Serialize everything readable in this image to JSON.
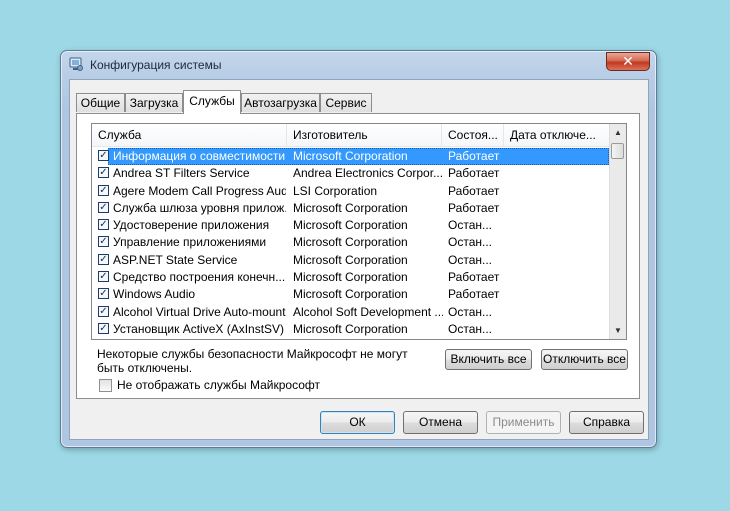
{
  "window": {
    "title": "Конфигурация системы",
    "close_glyph": "✕"
  },
  "tabs": [
    {
      "label": "Общие"
    },
    {
      "label": "Загрузка"
    },
    {
      "label": "Службы",
      "active": true
    },
    {
      "label": "Автозагрузка"
    },
    {
      "label": "Сервис"
    }
  ],
  "services": {
    "columns": [
      "Служба",
      "Изготовитель",
      "Состоя...",
      "Дата отключе..."
    ],
    "rows": [
      {
        "name": "Информация о совместимости ...",
        "maker": "Microsoft Corporation",
        "state": "Работает",
        "checked": true,
        "selected": true
      },
      {
        "name": "Andrea ST Filters Service",
        "maker": "Andrea Electronics Corpor...",
        "state": "Работает",
        "checked": true
      },
      {
        "name": "Agere Modem Call Progress Audio",
        "maker": "LSI Corporation",
        "state": "Работает",
        "checked": true
      },
      {
        "name": "Служба шлюза уровня прилож...",
        "maker": "Microsoft Corporation",
        "state": "Работает",
        "checked": true
      },
      {
        "name": "Удостоверение приложения",
        "maker": "Microsoft Corporation",
        "state": "Остан...",
        "checked": true
      },
      {
        "name": "Управление приложениями",
        "maker": "Microsoft Corporation",
        "state": "Остан...",
        "checked": true
      },
      {
        "name": "ASP.NET State Service",
        "maker": "Microsoft Corporation",
        "state": "Остан...",
        "checked": true
      },
      {
        "name": "Средство построения конечн...",
        "maker": "Microsoft Corporation",
        "state": "Работает",
        "checked": true
      },
      {
        "name": "Windows Audio",
        "maker": "Microsoft Corporation",
        "state": "Работает",
        "checked": true
      },
      {
        "name": "Alcohol Virtual Drive Auto-mount...",
        "maker": "Alcohol Soft Development ...",
        "state": "Остан...",
        "checked": true
      },
      {
        "name": "Установщик ActiveX (AxInstSV)",
        "maker": "Microsoft Corporation",
        "state": "Остан...",
        "checked": true
      }
    ]
  },
  "note": "Некоторые службы безопасности Майкрософт не могут быть отключены.",
  "buttons": {
    "enable_all": "Включить все",
    "disable_all": "Отключить все",
    "ok": "ОК",
    "cancel": "Отмена",
    "apply": "Применить",
    "help": "Справка"
  },
  "hide_ms": {
    "label": "Не отображать службы Майкрософт",
    "checked": false
  },
  "check_glyph": "✓",
  "scroll_up_glyph": "▲",
  "scroll_down_glyph": "▼"
}
